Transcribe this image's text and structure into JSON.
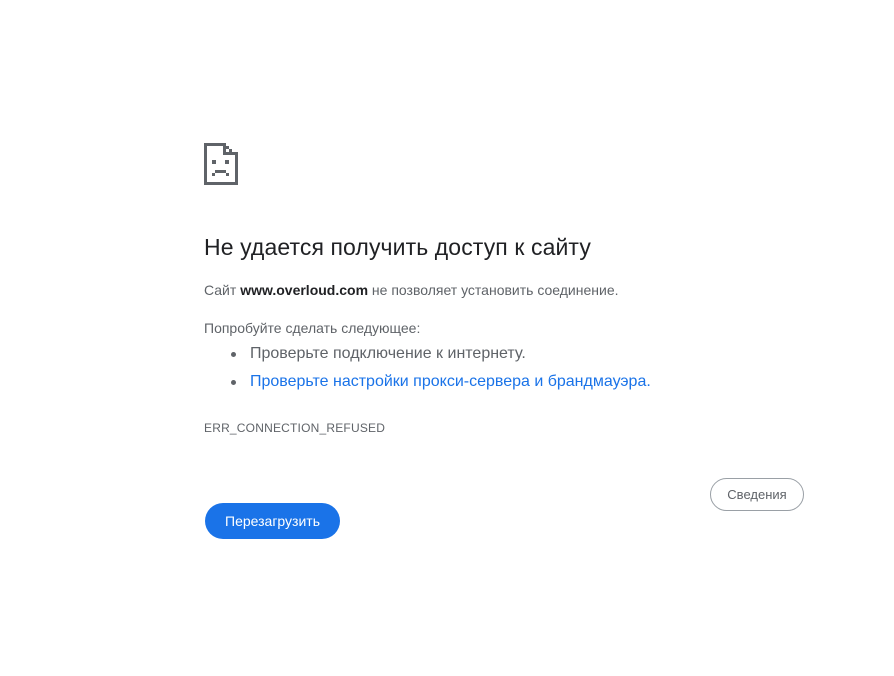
{
  "error": {
    "icon": "sad-page-icon",
    "title": "Не удается получить доступ к сайту",
    "summary_prefix": "Сайт ",
    "site": "www.overloud.com",
    "summary_suffix": " не позволяет установить соединение.",
    "try_label": "Попробуйте сделать следующее:",
    "suggestions": [
      {
        "text": "Проверьте подключение к интернету."
      },
      {
        "text": "Проверьте настройки прокси-сервера и брандмауэра.",
        "link": true
      }
    ],
    "code": "ERR_CONNECTION_REFUSED"
  },
  "buttons": {
    "details_label": "Сведения",
    "reload_label": "Перезагрузить"
  },
  "colors": {
    "accent": "#1a73e8",
    "title": "#202124",
    "text": "#5f6368",
    "background": "#ffffff"
  }
}
